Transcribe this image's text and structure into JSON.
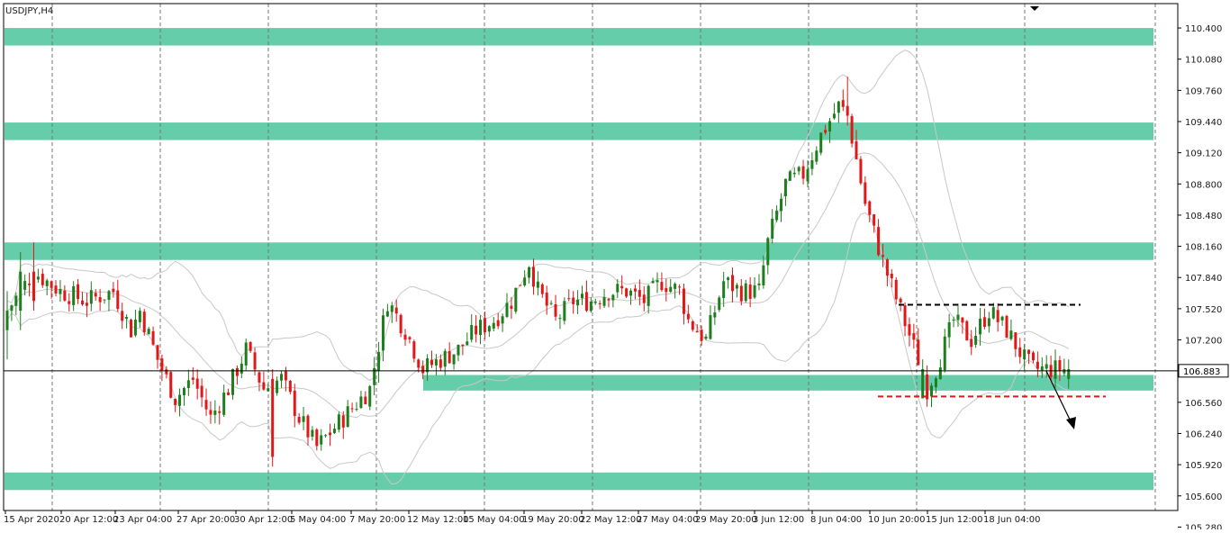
{
  "chart_data": {
    "type": "candlestick",
    "title": "USDJPY,H4",
    "symbol": "USDJPY",
    "timeframe": "H4",
    "current_price": "106.883",
    "ylim": [
      105.45,
      110.65
    ],
    "y_ticks": [
      "110.400",
      "110.080",
      "109.760",
      "109.440",
      "109.120",
      "108.800",
      "108.480",
      "108.160",
      "107.840",
      "107.520",
      "107.200",
      "106.560",
      "106.240",
      "105.920",
      "105.600",
      "105.280"
    ],
    "x_ticks": [
      "15 Apr 2020",
      "20 Apr 12:00",
      "23 Apr 04:00",
      "27 Apr 20:00",
      "30 Apr 12:00",
      "5 May 04:00",
      "7 May 20:00",
      "12 May 12:00",
      "15 May 04:00",
      "19 May 20:00",
      "22 May 12:00",
      "27 May 04:00",
      "29 May 20:00",
      "3 Jun 12:00",
      "8 Jun 04:00",
      "10 Jun 20:00",
      "15 Jun 12:00",
      "18 Jun 04:00"
    ],
    "close_path": [
      [
        0,
        107.5
      ],
      [
        6,
        107.9
      ],
      [
        12,
        107.7
      ],
      [
        18,
        107.6
      ],
      [
        24,
        107.7
      ],
      [
        28,
        107.3
      ],
      [
        30,
        107.5
      ],
      [
        34,
        107.0
      ],
      [
        38,
        106.6
      ],
      [
        42,
        106.8
      ],
      [
        46,
        106.4
      ],
      [
        50,
        106.7
      ],
      [
        54,
        107.1
      ],
      [
        58,
        106.7
      ],
      [
        62,
        106.8
      ],
      [
        66,
        106.4
      ],
      [
        70,
        106.1
      ],
      [
        74,
        106.3
      ],
      [
        78,
        106.5
      ],
      [
        82,
        106.7
      ],
      [
        86,
        107.6
      ],
      [
        90,
        107.3
      ],
      [
        94,
        106.9
      ],
      [
        98,
        107.0
      ],
      [
        102,
        107.1
      ],
      [
        106,
        107.3
      ],
      [
        110,
        107.4
      ],
      [
        114,
        107.6
      ],
      [
        118,
        108.0
      ],
      [
        120,
        107.7
      ],
      [
        124,
        107.4
      ],
      [
        128,
        107.6
      ],
      [
        132,
        107.6
      ],
      [
        136,
        107.7
      ],
      [
        140,
        107.7
      ],
      [
        144,
        107.6
      ],
      [
        148,
        107.8
      ],
      [
        152,
        107.7
      ],
      [
        154,
        107.4
      ],
      [
        158,
        107.2
      ],
      [
        162,
        107.8
      ],
      [
        166,
        107.7
      ],
      [
        170,
        107.7
      ],
      [
        172,
        108.2
      ],
      [
        176,
        108.8
      ],
      [
        180,
        108.9
      ],
      [
        184,
        109.3
      ],
      [
        188,
        109.6
      ],
      [
        190,
        109.5
      ],
      [
        194,
        108.6
      ],
      [
        198,
        108.0
      ],
      [
        202,
        107.5
      ],
      [
        206,
        107.0
      ],
      [
        208,
        106.7
      ],
      [
        210,
        106.9
      ],
      [
        214,
        107.4
      ],
      [
        218,
        107.2
      ],
      [
        222,
        107.5
      ],
      [
        226,
        107.3
      ],
      [
        230,
        107.0
      ],
      [
        232,
        106.9
      ],
      [
        236,
        106.9
      ],
      [
        240,
        106.9
      ]
    ],
    "candles": [
      {
        "i": 0,
        "o": 107.3,
        "h": 107.7,
        "l": 107.0,
        "c": 107.5,
        "bull": true
      },
      {
        "i": 3,
        "o": 107.5,
        "h": 108.1,
        "l": 107.3,
        "c": 107.9,
        "bull": true
      },
      {
        "i": 6,
        "o": 107.9,
        "h": 108.2,
        "l": 107.5,
        "c": 107.6,
        "bull": false
      },
      {
        "i": 60,
        "o": 106.8,
        "h": 106.9,
        "l": 105.9,
        "c": 106.0,
        "bull": false
      },
      {
        "i": 190,
        "o": 109.6,
        "h": 109.9,
        "l": 109.4,
        "c": 109.5,
        "bull": false
      },
      {
        "i": 207,
        "o": 106.6,
        "h": 107.0,
        "l": 106.6,
        "c": 106.9,
        "bull": true
      },
      {
        "i": 240,
        "o": 106.8,
        "h": 107.0,
        "l": 106.7,
        "c": 106.9,
        "bull": true
      }
    ],
    "zones": [
      {
        "from": 110.22,
        "to": 110.4
      },
      {
        "from": 109.25,
        "to": 109.43
      },
      {
        "from": 108.02,
        "to": 108.2
      },
      {
        "from": 106.68,
        "to": 106.84
      },
      {
        "from": 105.66,
        "to": 105.84
      }
    ],
    "resistance_level": 107.56,
    "support_level": 106.62,
    "colors": {
      "zone": "#66cdaa",
      "bull": "#1e7e1e",
      "bear": "#e01818",
      "grid": "#777777",
      "band": "#c8c8c8",
      "resistance_line": "#000000",
      "support_line": "#e01818",
      "price_line": "#000000"
    },
    "grid": "vertical dashed",
    "arrow": "down-right"
  }
}
